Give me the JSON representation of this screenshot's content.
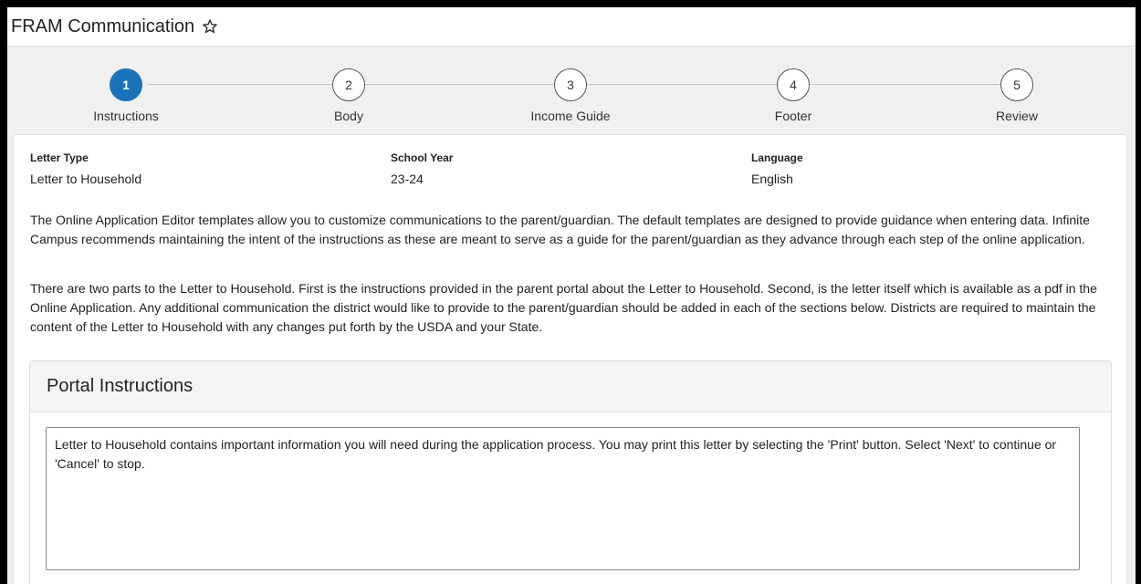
{
  "app": {
    "title": "FRAM Communication"
  },
  "stepper": {
    "steps": [
      {
        "number": "1",
        "label": "Instructions",
        "active": true
      },
      {
        "number": "2",
        "label": "Body",
        "active": false
      },
      {
        "number": "3",
        "label": "Income Guide",
        "active": false
      },
      {
        "number": "4",
        "label": "Footer",
        "active": false
      },
      {
        "number": "5",
        "label": "Review",
        "active": false
      }
    ],
    "active_color": "#1a73b8"
  },
  "info": {
    "letter_type_label": "Letter Type",
    "letter_type_value": "Letter to Household",
    "school_year_label": "School Year",
    "school_year_value": "23-24",
    "language_label": "Language",
    "language_value": "English"
  },
  "content": {
    "paragraph1": "The Online Application Editor templates allow you to customize communications to the parent/guardian. The default templates are designed to provide guidance when entering data. Infinite Campus recommends maintaining the intent of the instructions as these are meant to serve as a guide for the parent/guardian as they advance through each step of the online application.",
    "paragraph2": "There are two parts to the Letter to Household. First is the instructions provided in the parent portal about the Letter to Household. Second, is the letter itself which is available as a pdf in the Online Application. Any additional communication the district would like to provide to the parent/guardian should be added in each of the sections below. Districts are required to maintain the content of the Letter to Household with any changes put forth by the USDA and your State."
  },
  "portal_instructions": {
    "heading": "Portal Instructions",
    "text": "Letter to Household contains important information you will need during the application process. You may print this letter by selecting the 'Print' button. Select 'Next' to continue or 'Cancel' to stop."
  },
  "icons": {
    "favorite": "star-outline-icon",
    "resize": "resize-grip-icon"
  }
}
